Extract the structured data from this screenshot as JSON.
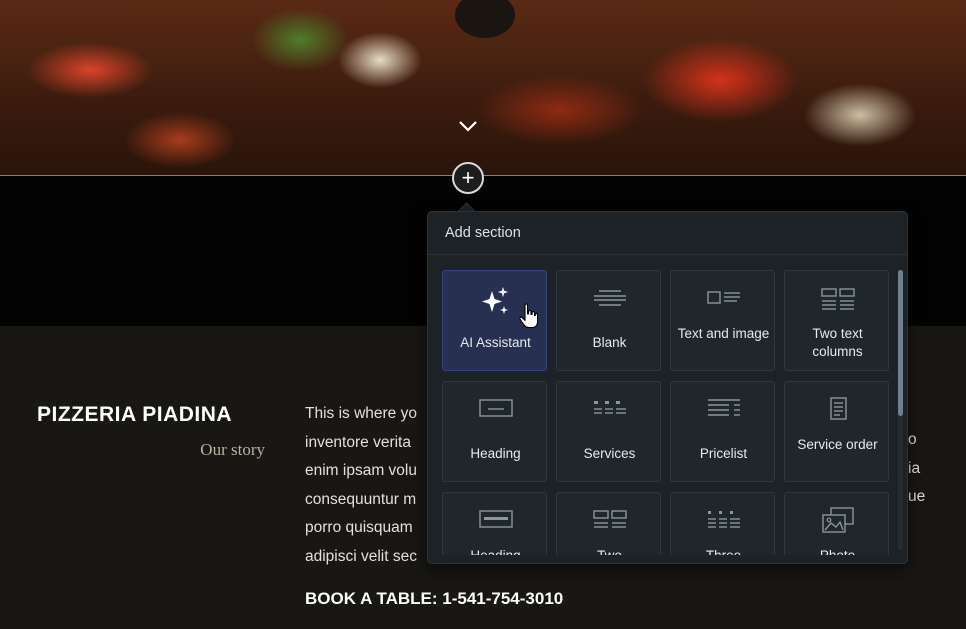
{
  "story": {
    "title": "PIZZERIA PIADINA",
    "subtitle": "Our story",
    "lines": [
      "This is where yo",
      "inventore verita",
      "enim ipsam volu",
      "consequuntur m",
      "porro quisquam",
      "adipisci velit sec"
    ],
    "line_ends": [
      "o",
      "ia",
      "ue"
    ],
    "book": "BOOK A TABLE: 1-541-754-3010"
  },
  "add_button": {
    "symbol": "+"
  },
  "panel": {
    "title": "Add section",
    "tiles": [
      {
        "label": "AI Assistant",
        "icon": "sparkle-icon",
        "active": true
      },
      {
        "label": "Blank",
        "icon": "blank-icon"
      },
      {
        "label": "Text and image",
        "icon": "text-image-icon"
      },
      {
        "label": "Two text columns",
        "icon": "two-columns-icon"
      },
      {
        "label": "Heading",
        "icon": "heading-icon"
      },
      {
        "label": "Services",
        "icon": "services-icon"
      },
      {
        "label": "Pricelist",
        "icon": "pricelist-icon"
      },
      {
        "label": "Service order",
        "icon": "service-order-icon"
      },
      {
        "label": "Heading",
        "icon": "heading-icon"
      },
      {
        "label": "Two",
        "icon": "two-columns-icon"
      },
      {
        "label": "Three",
        "icon": "three-columns-icon"
      },
      {
        "label": "Photo",
        "icon": "photo-icon"
      }
    ]
  },
  "colors": {
    "accent_active": "#283052",
    "panel_bg": "#1c2226",
    "page_bg": "#191714"
  }
}
